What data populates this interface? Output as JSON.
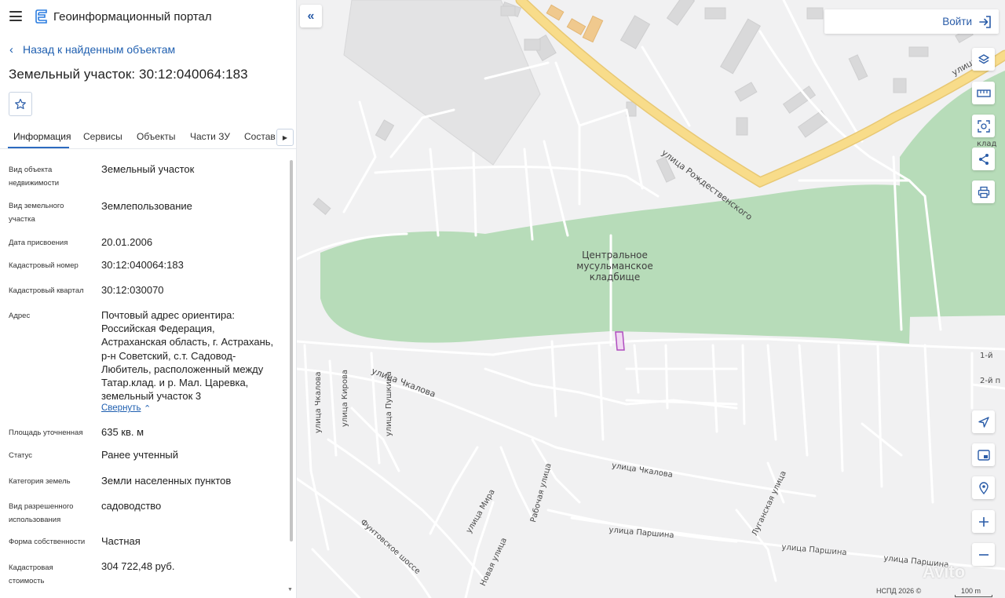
{
  "header": {
    "app_title": "Геоинформационный портал",
    "back_label": "Назад к найденным объектам",
    "object_title": "Земельный участок: 30:12:040064:183"
  },
  "tabs": [
    {
      "label": "Информация",
      "active": true
    },
    {
      "label": "Сервисы"
    },
    {
      "label": "Объекты"
    },
    {
      "label": "Части ЗУ"
    },
    {
      "label": "Состав"
    }
  ],
  "properties": [
    {
      "label": "Вид объекта недвижимости",
      "value": "Земельный участок"
    },
    {
      "label": "Вид земельного участка",
      "value": "Землепользование"
    },
    {
      "label": "Дата присвоения",
      "value": "20.01.2006"
    },
    {
      "label": "Кадастровый номер",
      "value": "30:12:040064:183"
    },
    {
      "label": "Кадастровый квартал",
      "value": "30:12:030070"
    },
    {
      "label": "Адрес",
      "value": "Почтовый адрес ориентира: Российская Федерация, Астраханская область, г. Астрахань, р-н Советский, с.т. Садовод-Любитель, расположенный между Татар.клад. и р. Мал. Царевка, земельный участок 3"
    },
    {
      "label": "Площадь уточненная",
      "value": "635 кв. м"
    },
    {
      "label": "Статус",
      "value": "Ранее учтенный"
    },
    {
      "label": "Категория земель",
      "value": "Земли населенных пунктов"
    },
    {
      "label": "Вид разрешенного использования",
      "value": "садоводство"
    },
    {
      "label": "Форма собственности",
      "value": "Частная"
    },
    {
      "label": "Кадастровая стоимость",
      "value": "304 722,48 руб."
    }
  ],
  "address_collapse_label": "Свернуть",
  "map": {
    "login_label": "Войти",
    "cemetery_label": "Центральное мусульманское кладбище",
    "streets": {
      "rozhdestvenskogo": "улица Рождественского",
      "chkalova_1": "улица Чкалова",
      "chkalova_2": "улица Чкалова",
      "chkalova_3": "улица Чкалова",
      "kirova": "улица Кирова",
      "pushkina": "улица Пушкина",
      "mira": "улица Мира",
      "rabochaya": "Рабочая улица",
      "novaya": "Новая улица",
      "funtovskoe": "Фунтовское шоссе",
      "parshina_1": "улица Паршина",
      "parshina_2": "улица Паршина",
      "parshina_3": "улица Паршина",
      "luganskaya": "Луганская улица",
      "lane_1": "1-й",
      "lane_2": "2-й п",
      "partial_top": "улица",
      "partial_right": "клад"
    },
    "attribution": "НСПД 2026 ©",
    "scale_label": "100 m",
    "watermark": "Avito",
    "colors": {
      "park": "#b7dcb9",
      "major_road": "#f8dc8a",
      "accent": "#2a5ca8",
      "parcel_outline": "#b04dbf"
    }
  }
}
